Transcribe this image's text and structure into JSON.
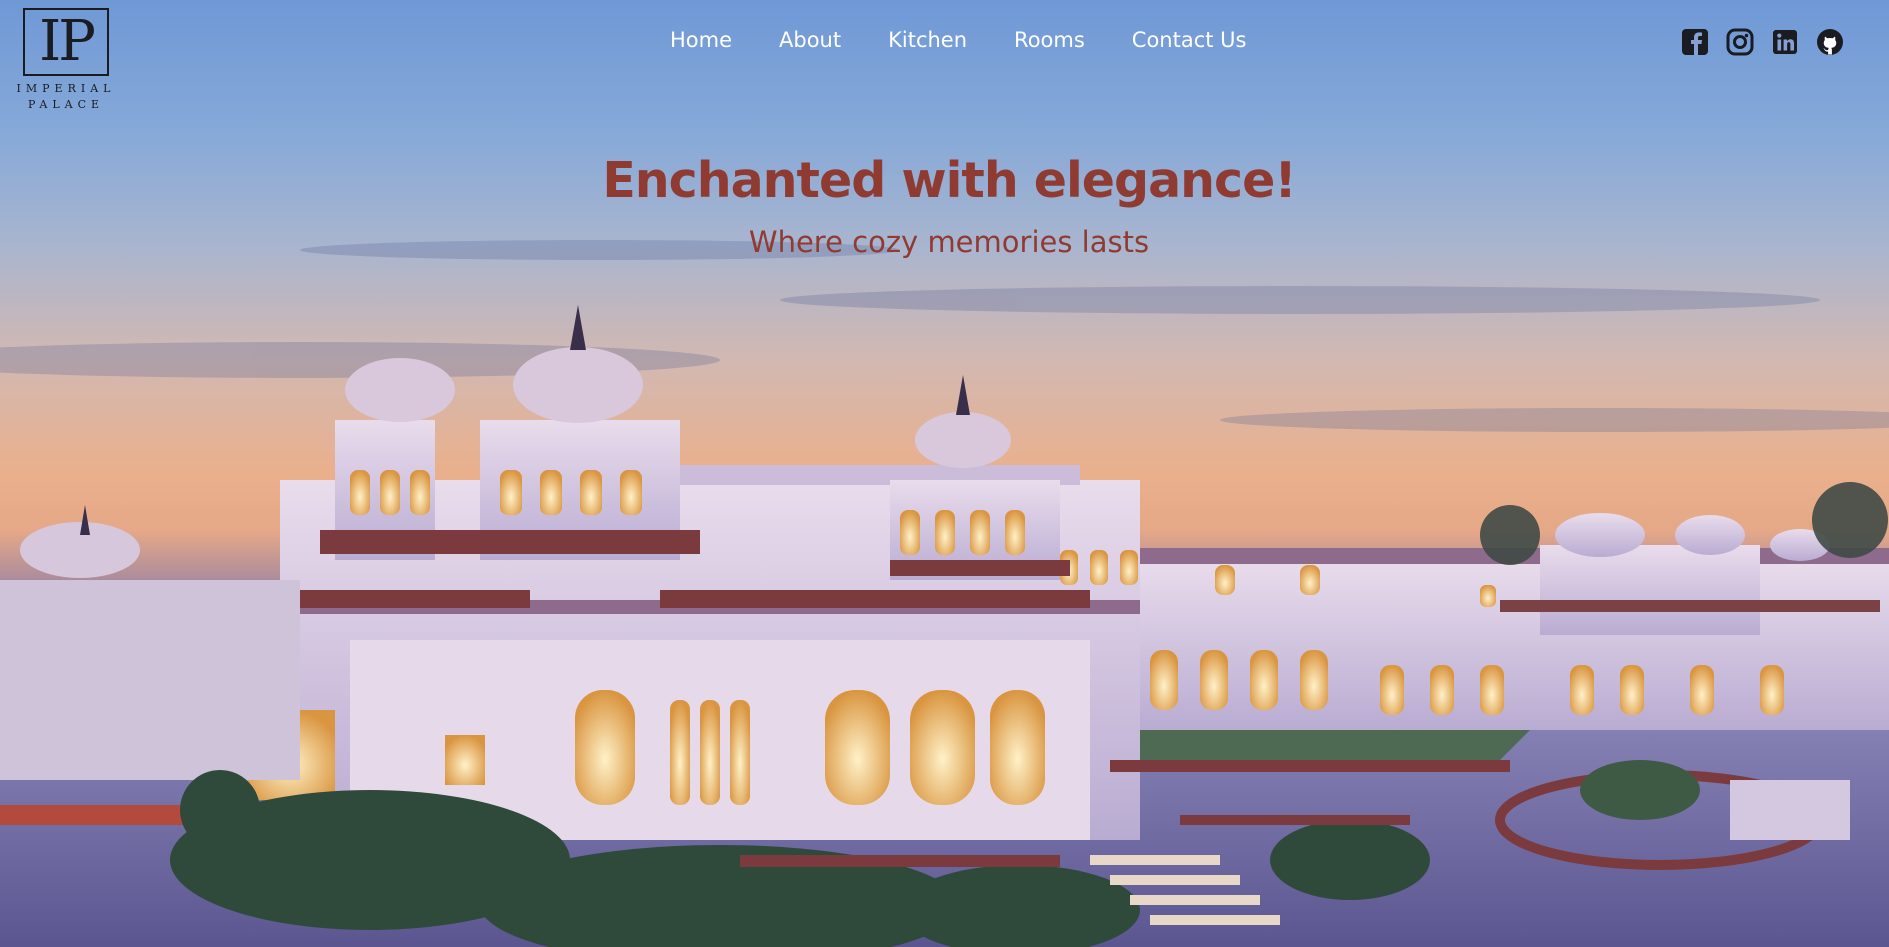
{
  "brand": {
    "monogram": "IP",
    "name": "IMPERIAL PALACE"
  },
  "nav": {
    "items": [
      "Home",
      "About",
      "Kitchen",
      "Rooms",
      "Contact Us"
    ]
  },
  "social": {
    "icons": [
      "facebook-icon",
      "instagram-icon",
      "linkedin-icon",
      "github-icon"
    ]
  },
  "hero": {
    "title": "Enchanted with elegance!",
    "subtitle": "Where cozy memories lasts"
  },
  "colors": {
    "accent": "#8f3b32",
    "nav_text": "#ffffff",
    "icon_dark": "#1b1b22"
  }
}
